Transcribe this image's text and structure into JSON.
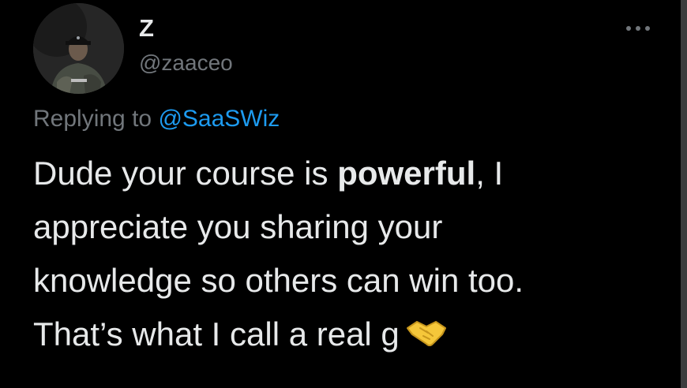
{
  "author": {
    "display_name": "Z",
    "handle": "@zaaceo"
  },
  "reply": {
    "prefix": "Replying to",
    "mention": "@SaaSWiz"
  },
  "tweet": {
    "line1_before": "Dude your course is ",
    "line1_bold": "powerful",
    "line1_after": ", I",
    "line2": "appreciate you sharing your",
    "line3": "knowledge so others can win too.",
    "line4": "That’s what I call a real g"
  },
  "icons": {
    "more": "more-options-icon",
    "emoji": "handshake-emoji-icon"
  },
  "colors": {
    "background": "#000000",
    "text_primary": "#e7e9ea",
    "text_secondary": "#71767b",
    "link": "#1d9bf0",
    "emoji": "#f5c73a"
  }
}
